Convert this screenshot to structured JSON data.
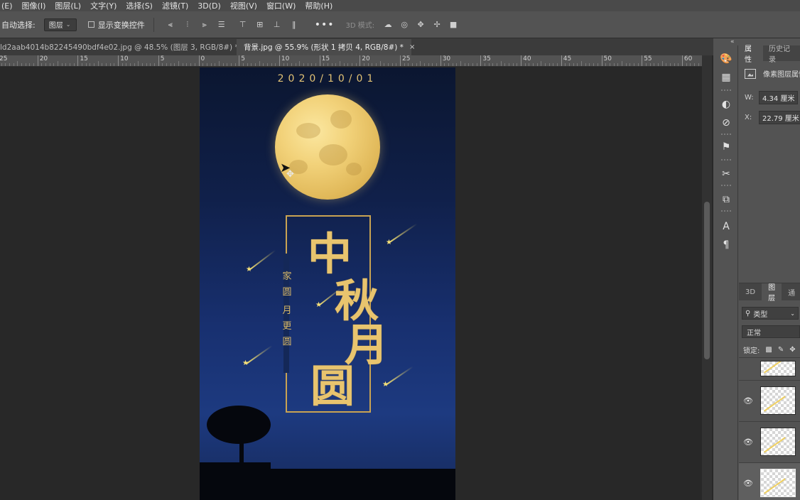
{
  "menubar": {
    "items": [
      "(E)",
      "图像(I)",
      "图层(L)",
      "文字(Y)",
      "选择(S)",
      "滤镜(T)",
      "3D(D)",
      "视图(V)",
      "窗口(W)",
      "帮助(H)"
    ]
  },
  "options": {
    "auto_select_label": "自动选择:",
    "auto_select_value": "图层",
    "show_transform_label": "显示变换控件",
    "more_label": "•••",
    "mode_3d_label": "3D 模式:"
  },
  "tabs": [
    {
      "label": "ld2aab4014b82245490bdf4e02.jpg @ 48.5% (图层 3, RGB/8#) *",
      "close": "×"
    },
    {
      "label": "背景.jpg @ 55.9% (形状 1 拷贝 4, RGB/8#) *",
      "close": "×"
    }
  ],
  "ruler": {
    "labels": [
      "25",
      "20",
      "15",
      "10",
      "5",
      "0",
      "5",
      "10",
      "15",
      "20",
      "25",
      "30",
      "35",
      "40",
      "45",
      "50",
      "55",
      "60"
    ]
  },
  "poster": {
    "date": "2020/10/01",
    "side_line1": [
      "家",
      "圆"
    ],
    "side_line2": [
      "月",
      "更",
      "圆"
    ],
    "title_chars": [
      "中",
      "秋",
      "月",
      "圆"
    ]
  },
  "properties": {
    "tab_properties": "属性",
    "tab_history": "历史记录",
    "layer_type": "像素图层属性",
    "w_label": "W:",
    "w_value": "4.34 厘米",
    "x_label": "X:",
    "x_value": "22.79 厘米"
  },
  "layers": {
    "tab_3d": "3D",
    "tab_layers": "图层",
    "tab_channels": "通",
    "filter_label": "类型",
    "blend_mode": "正常",
    "lock_label": "锁定:"
  },
  "colors": {
    "poster_gold": "#e8c46e",
    "moon": "#f2d27a",
    "sky_top": "#0b1630",
    "sky_bottom": "#1d3a80",
    "ui_panel": "#535353",
    "ui_bg": "#282828"
  }
}
